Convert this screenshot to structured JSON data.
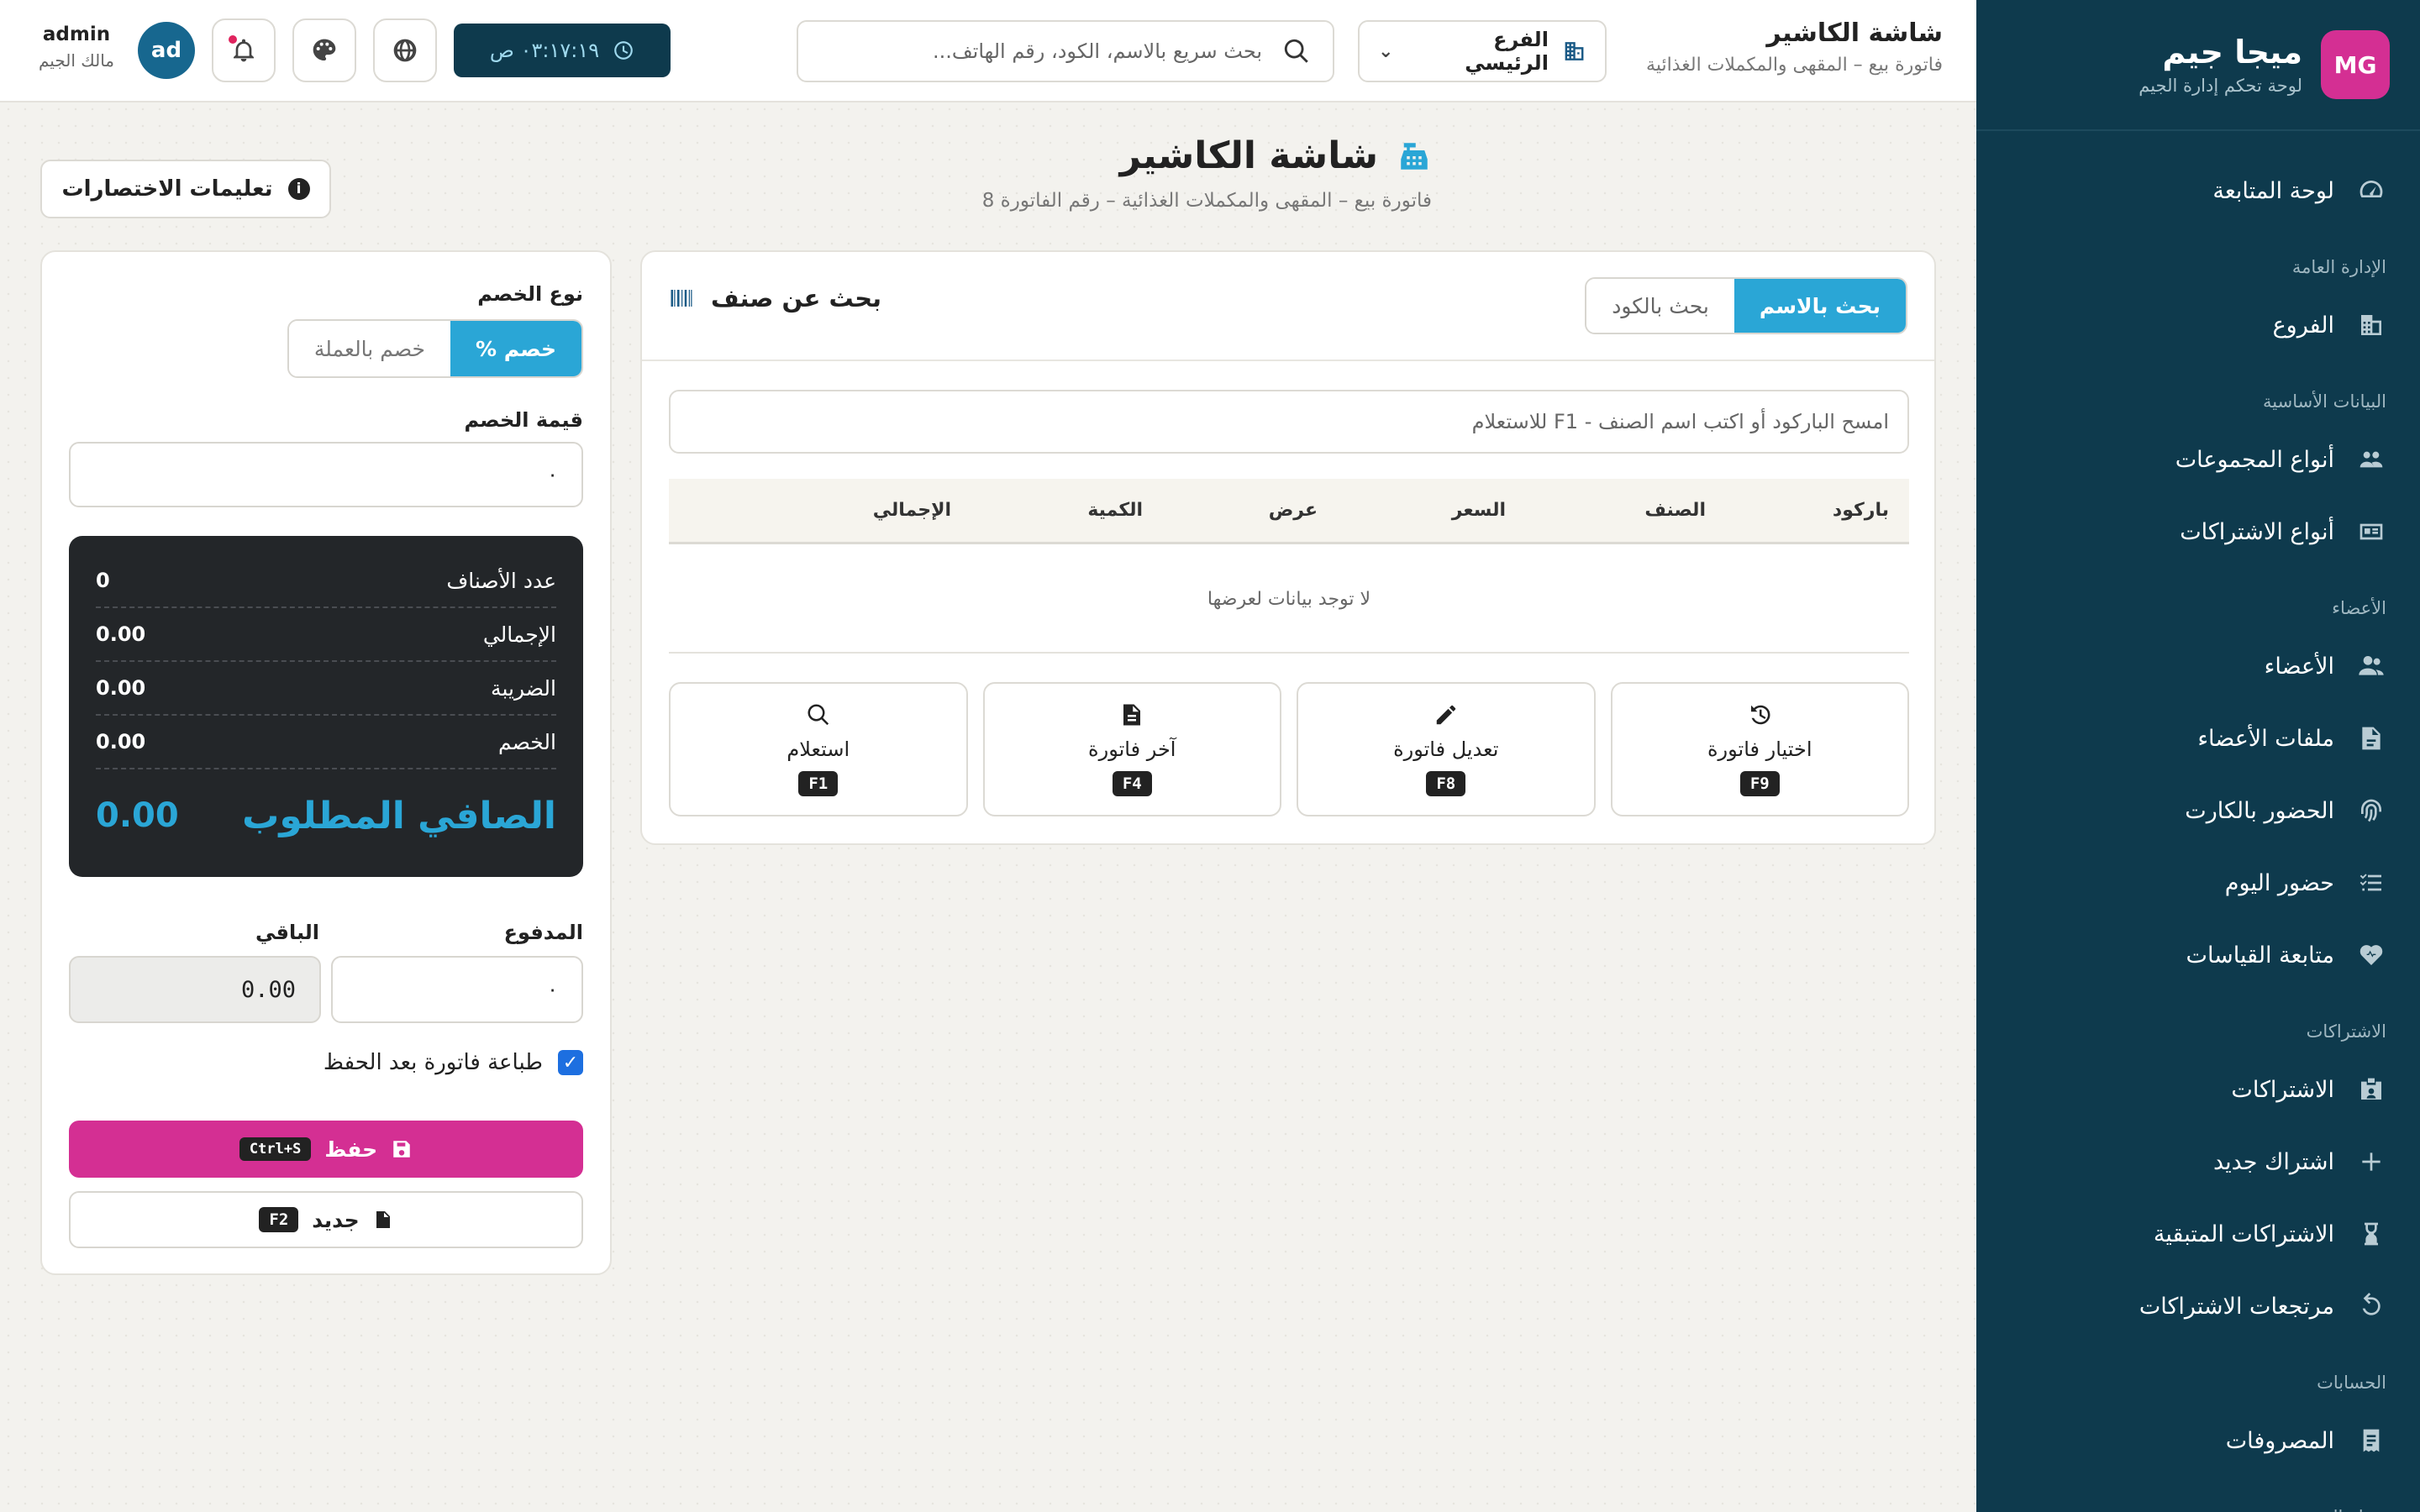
{
  "sidebar": {
    "logo_initials": "MG",
    "brand_name": "ميجا جيم",
    "brand_sub": "لوحة تحكم إدارة الجيم",
    "items": [
      {
        "type": "item",
        "label": "لوحة المتابعة",
        "icon": "gauge-icon"
      },
      {
        "type": "section",
        "label": "الإدارة العامة"
      },
      {
        "type": "item",
        "label": "الفروع",
        "icon": "building-icon"
      },
      {
        "type": "section",
        "label": "البيانات الأساسية"
      },
      {
        "type": "item",
        "label": "أنواع المجموعات",
        "icon": "group-icon"
      },
      {
        "type": "item",
        "label": "أنواع الاشتراكات",
        "icon": "id-card-icon"
      },
      {
        "type": "section",
        "label": "الأعضاء"
      },
      {
        "type": "item",
        "label": "الأعضاء",
        "icon": "users-icon"
      },
      {
        "type": "item",
        "label": "ملفات الأعضاء",
        "icon": "file-icon"
      },
      {
        "type": "item",
        "label": "الحضور بالكارت",
        "icon": "fingerprint-icon"
      },
      {
        "type": "item",
        "label": "حضور اليوم",
        "icon": "list-check-icon"
      },
      {
        "type": "item",
        "label": "متابعة القياسات",
        "icon": "heart-pulse-icon"
      },
      {
        "type": "section",
        "label": "الاشتراكات"
      },
      {
        "type": "item",
        "label": "الاشتراكات",
        "icon": "badge-icon"
      },
      {
        "type": "item",
        "label": "اشتراك جديد",
        "icon": "plus-icon"
      },
      {
        "type": "item",
        "label": "الاشتراكات المتبقية",
        "icon": "hourglass-icon"
      },
      {
        "type": "item",
        "label": "مرتجعات الاشتراكات",
        "icon": "undo-icon"
      },
      {
        "type": "section",
        "label": "الحسابات"
      },
      {
        "type": "item",
        "label": "المصروفات",
        "icon": "receipt-icon"
      },
      {
        "type": "section",
        "label": "نقطة البيع"
      }
    ]
  },
  "topbar": {
    "title": "شاشة الكاشير",
    "subtitle": "فاتورة بيع – المقهى والمكملات الغذائية",
    "branch": "الفرع الرئيسي",
    "search_placeholder": "بحث سريع بالاسم، الكود، رقم الهاتف...",
    "clock": "٠٣:١٧:١٩ ص",
    "user_name": "admin",
    "user_role": "مالك الجيم",
    "avatar_initials": "ad"
  },
  "page": {
    "title": "شاشة الكاشير",
    "subtitle": "فاتورة بيع – المقهى والمكملات الغذائية – رقم الفاتورة 8",
    "shortcuts_label": "تعليمات الاختصارات"
  },
  "item_search": {
    "title": "بحث عن صنف",
    "tab_by_name": "بحث بالاسم",
    "tab_by_code": "بحث بالكود",
    "input_placeholder": "امسح الباركود أو اكتب اسم الصنف - F1 للاستعلام",
    "columns": [
      "باركود",
      "الصنف",
      "السعر",
      "عرض",
      "الكمية",
      "الإجمالي"
    ],
    "empty_text": "لا توجد بيانات لعرضها",
    "actions": [
      {
        "label": "اختيار فاتورة",
        "key": "F9",
        "icon": "history-icon"
      },
      {
        "label": "تعديل فاتورة",
        "key": "F8",
        "icon": "pencil-icon"
      },
      {
        "label": "آخر فاتورة",
        "key": "F4",
        "icon": "document-icon"
      },
      {
        "label": "استعلام",
        "key": "F1",
        "icon": "search-icon"
      }
    ]
  },
  "checkout": {
    "discount_type_label": "نوع الخصم",
    "discount_percent": "خصم %",
    "discount_currency": "خصم بالعملة",
    "discount_value_label": "قيمة الخصم",
    "discount_value": "٠",
    "summary": {
      "items_count_label": "عدد الأصناف",
      "items_count": "0",
      "total_label": "الإجمالي",
      "total": "0.00",
      "tax_label": "الضريبة",
      "tax": "0.00",
      "discount_label": "الخصم",
      "discount": "0.00",
      "net_label": "الصافي المطلوب",
      "net": "0.00"
    },
    "paid_label": "المدفوع",
    "paid_value": "٠",
    "remaining_label": "الباقي",
    "remaining_value": "0.00",
    "print_after_save": "طباعة فاتورة بعد الحفظ",
    "save_label": "حفظ",
    "save_key": "Ctrl+S",
    "new_label": "جديد",
    "new_key": "F2"
  },
  "colors": {
    "sidebar_bg": "#0e3a4d",
    "accent": "#2aa6d6",
    "brand_pink": "#d42f93",
    "summary_bg": "#232629"
  }
}
